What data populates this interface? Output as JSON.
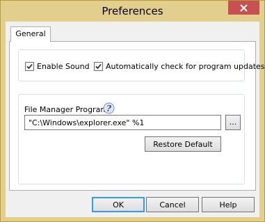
{
  "window": {
    "title": "Preferences"
  },
  "tabs": [
    {
      "label": "General"
    }
  ],
  "options": {
    "enable_sound": {
      "label": "Enable Sound",
      "checked": true
    },
    "auto_update": {
      "label": "Automatically check for program updates",
      "checked": true
    }
  },
  "file_manager": {
    "label": "File Manager Program:",
    "value": "\"C:\\Windows\\explorer.exe\" %1",
    "browse_label": "...",
    "restore_label": "Restore Default"
  },
  "buttons": {
    "ok": "OK",
    "cancel": "Cancel",
    "help": "Help"
  },
  "icons": {
    "close": "close-icon",
    "help": "help-icon",
    "checkmark": "checkmark-icon"
  },
  "colors": {
    "frame": "#e2cf8d",
    "close_button": "#c75050",
    "default_button_focus": "#3399ff"
  }
}
